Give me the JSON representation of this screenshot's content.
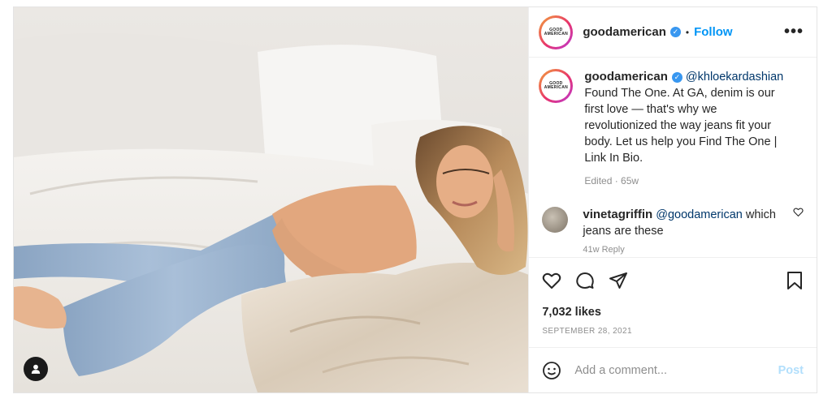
{
  "post": {
    "author": {
      "username": "goodamerican",
      "avatar_text": "GOOD AMERICAN",
      "verified": true
    },
    "follow_label": "Follow",
    "separator": "•",
    "more_label": "•••",
    "caption": {
      "username": "goodamerican",
      "mention": "@khloekardashian",
      "text": "Found The One. At GA, denim is our first love — that's why we revolutionized the way jeans fit your body. Let us help you Find The One | Link In Bio.",
      "edited": "Edited · 65w"
    },
    "comments": [
      {
        "username": "vinetagriffin",
        "mention": "@goodamerican",
        "text": "which jeans are these",
        "meta": "41w   Reply"
      }
    ],
    "likes": "7,032 likes",
    "date": "SEPTEMBER 28, 2021",
    "add_comment_placeholder": "Add a comment...",
    "post_button": "Post"
  },
  "icons": {
    "user_tag": "user-tag-icon",
    "like": "heart-icon",
    "comment": "comment-icon",
    "share": "paper-plane-icon",
    "save": "bookmark-icon",
    "emoji": "emoji-icon",
    "comment_like": "heart-small-icon"
  },
  "colors": {
    "link": "#0095f6",
    "verified": "#3897f0",
    "muted": "#8e8e8e",
    "post_disabled": "#b2dffc"
  }
}
